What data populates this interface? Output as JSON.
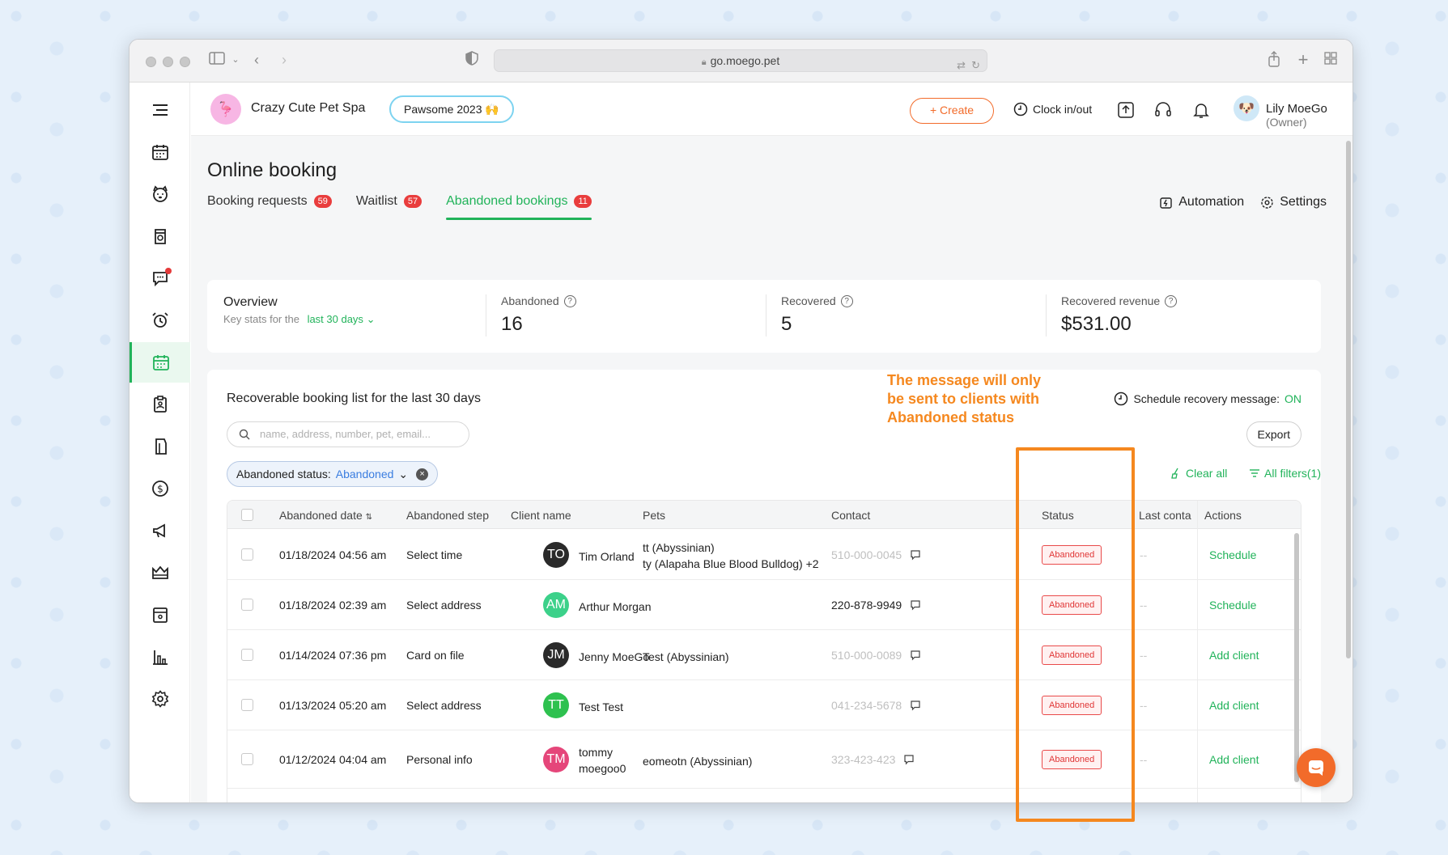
{
  "browser": {
    "url": "go.moego.pet"
  },
  "topbar": {
    "business_name": "Crazy Cute Pet Spa",
    "promo_label": "Pawsome 2023 🙌",
    "create_label": "+ Create",
    "clock_label": "Clock in/out",
    "user_name": "Lily MoeGo",
    "user_role": "(Owner)"
  },
  "page": {
    "title": "Online booking",
    "tabs": [
      {
        "label": "Booking requests",
        "count": "59"
      },
      {
        "label": "Waitlist",
        "count": "57"
      },
      {
        "label": "Abandoned bookings",
        "count": "11"
      }
    ],
    "automation_label": "Automation",
    "settings_label": "Settings"
  },
  "overview": {
    "title": "Overview",
    "subtitle_prefix": "Key stats for the",
    "period": "last 30 days",
    "stats": [
      {
        "label": "Abandoned",
        "value": "16"
      },
      {
        "label": "Recovered",
        "value": "5"
      },
      {
        "label": "Recovered revenue",
        "value": "$531.00"
      }
    ]
  },
  "list": {
    "title": "Recoverable booking list for the last 30 days",
    "schedule_label": "Schedule recovery message:",
    "schedule_state": "ON",
    "search_placeholder": "name, address, number, pet, email...",
    "export_label": "Export",
    "filter_label": "Abandoned status:",
    "filter_value": "Abandoned",
    "clear_all": "Clear all",
    "all_filters": "All filters(1)",
    "columns": [
      "Abandoned date",
      "Abandoned step",
      "Client name",
      "Pets",
      "Contact",
      "Status",
      "Last conta",
      "Actions"
    ],
    "rows": [
      {
        "date": "01/18/2024 04:56 am",
        "step": "Select time",
        "initials": "TO",
        "avatar_color": "#2a2a2a",
        "name_line1": "Tim Orland",
        "name_line2": "",
        "pets_line1": "tt (Abyssinian)",
        "pets_line2": "ty (Alapaha Blue Blood Bulldog) +2",
        "contact": "510-000-0045",
        "contact_gray": true,
        "status": "Abandoned",
        "last_contact": "--",
        "action": "Schedule"
      },
      {
        "date": "01/18/2024 02:39 am",
        "step": "Select address",
        "initials": "AM",
        "avatar_color": "#3cd18a",
        "name_line1": "Arthur Morgan",
        "name_line2": "",
        "pets_line1": "",
        "pets_line2": "",
        "contact": "220-878-9949",
        "contact_gray": false,
        "status": "Abandoned",
        "last_contact": "--",
        "action": "Schedule"
      },
      {
        "date": "01/14/2024 07:36 pm",
        "step": "Card on file",
        "initials": "JM",
        "avatar_color": "#2a2a2a",
        "name_line1": "Jenny MoeGo",
        "name_line2": "",
        "pets_line1": "Test (Abyssinian)",
        "pets_line2": "",
        "contact": "510-000-0089",
        "contact_gray": true,
        "status": "Abandoned",
        "last_contact": "--",
        "action": "Add client"
      },
      {
        "date": "01/13/2024 05:20 am",
        "step": "Select address",
        "initials": "TT",
        "avatar_color": "#2ec14f",
        "name_line1": "Test Test",
        "name_line2": "",
        "pets_line1": "",
        "pets_line2": "",
        "contact": "041-234-5678",
        "contact_gray": true,
        "status": "Abandoned",
        "last_contact": "--",
        "action": "Add client"
      },
      {
        "date": "01/12/2024 04:04 am",
        "step": "Personal info",
        "initials": "TM",
        "avatar_color": "#e5467a",
        "name_line1": "tommy",
        "name_line2": "moegoo0",
        "pets_line1": "eomeotn (Abyssinian)",
        "pets_line2": "",
        "contact": "323-423-423",
        "contact_gray": true,
        "status": "Abandoned",
        "last_contact": "--",
        "action": "Add client"
      }
    ]
  },
  "annotation": {
    "text_line1": "The message will only",
    "text_line2": "be sent to clients with",
    "text_line3": "Abandoned status",
    "color": "#f5881f"
  },
  "nav_icons": [
    "menu-icon",
    "calendar-icon",
    "pet-icon",
    "grooming-icon",
    "chat-icon",
    "alarm-icon",
    "online-booking-icon",
    "clipboard-icon",
    "retail-icon",
    "finance-icon",
    "marketing-icon",
    "membership-icon",
    "agreement-icon",
    "reports-icon",
    "settings-icon"
  ]
}
